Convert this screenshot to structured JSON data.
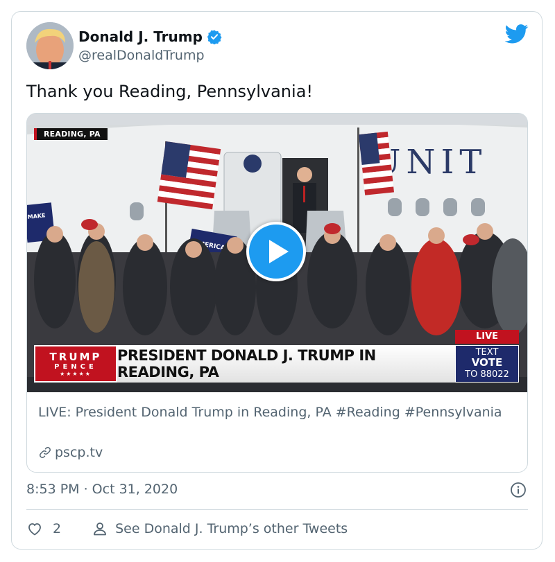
{
  "author": {
    "name": "Donald J. Trump",
    "handle": "@realDonaldTrump"
  },
  "tweet": {
    "text": "Thank you Reading, Pennsylvania!",
    "timestamp": "8:53 PM · Oct 31, 2020"
  },
  "media": {
    "location_tag": "READING, PA",
    "plane_text": "UNIT",
    "sign_text": "MAKE AMERICA GREAT AGAIN",
    "lower_third": {
      "logo_line1": "TRUMP",
      "logo_line2": "PENCE",
      "logo_stars": "★★★★★",
      "headline": "PRESIDENT DONALD J. TRUMP IN READING, PA",
      "live": "LIVE",
      "vote_line1": "TEXT",
      "vote_line2": "VOTE",
      "vote_line3": "TO 88022"
    },
    "caption": "LIVE: President Donald Trump in Reading, PA #Reading #Pennsylvania",
    "link": "pscp.tv"
  },
  "actions": {
    "like_count": "2",
    "other_tweets": "See Donald J. Trump’s other Tweets"
  },
  "colors": {
    "twitter_blue": "#1d9bf0",
    "text_primary": "#0f1419",
    "text_secondary": "#536471",
    "border": "#cfd9de",
    "broadcast_red": "#c1121f",
    "broadcast_navy": "#1e2a6b"
  }
}
